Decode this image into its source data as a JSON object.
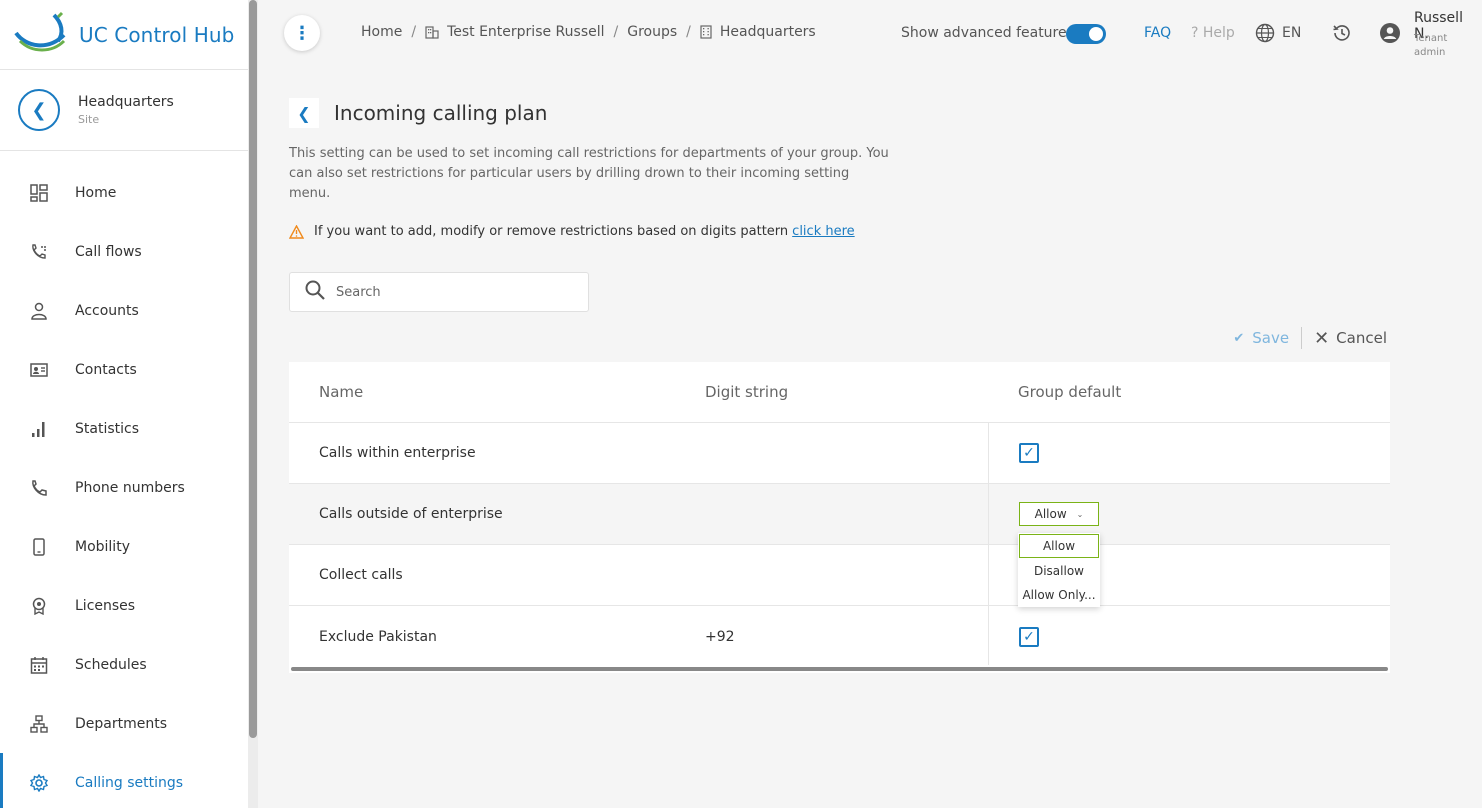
{
  "app": {
    "title": "UC Control Hub",
    "colors": {
      "accent": "#1a7bc1",
      "select_border": "#7ab317",
      "warning": "#f08a1c"
    }
  },
  "site": {
    "name": "Headquarters",
    "type": "Site"
  },
  "sidebar": {
    "items": [
      {
        "label": "Home",
        "icon": "dashboard-icon"
      },
      {
        "label": "Call flows",
        "icon": "call-flow-icon"
      },
      {
        "label": "Accounts",
        "icon": "person-icon"
      },
      {
        "label": "Contacts",
        "icon": "contact-card-icon"
      },
      {
        "label": "Statistics",
        "icon": "bar-chart-icon"
      },
      {
        "label": "Phone numbers",
        "icon": "phone-icon"
      },
      {
        "label": "Mobility",
        "icon": "mobile-icon"
      },
      {
        "label": "Licenses",
        "icon": "license-badge-icon"
      },
      {
        "label": "Schedules",
        "icon": "calendar-icon"
      },
      {
        "label": "Departments",
        "icon": "org-chart-icon"
      },
      {
        "label": "Calling settings",
        "icon": "gear-icon",
        "active": true
      }
    ]
  },
  "header": {
    "breadcrumb": [
      "Home",
      "Test Enterprise Russell",
      "Groups",
      "Headquarters"
    ],
    "advanced_label": "Show advanced features",
    "advanced_on": true,
    "faq": "FAQ",
    "help": "? Help",
    "lang": "EN",
    "user_name": "Russell N.",
    "user_role": "Tenant admin"
  },
  "page": {
    "title": "Incoming calling plan",
    "description": "This setting can be used to set incoming call restrictions for departments of your group. You can also set restrictions for particular users by drilling drown to their incoming setting menu.",
    "warning_text": "If you want to add, modify or remove restrictions based on digits pattern",
    "warning_link": "click here",
    "search_placeholder": "Search",
    "save": "Save",
    "cancel": "Cancel"
  },
  "table": {
    "columns": [
      "Name",
      "Digit string",
      "Group default"
    ],
    "rows": [
      {
        "name": "Calls within enterprise",
        "digits": "",
        "default": "checked"
      },
      {
        "name": "Calls outside of enterprise",
        "digits": "",
        "default": "Allow"
      },
      {
        "name": "Collect calls",
        "digits": "",
        "default": ""
      },
      {
        "name": "Exclude Pakistan",
        "digits": "+92",
        "default": "checked"
      }
    ]
  },
  "dropdown": {
    "selected": "Allow",
    "options": [
      "Allow",
      "Disallow",
      "Allow Only..."
    ]
  }
}
